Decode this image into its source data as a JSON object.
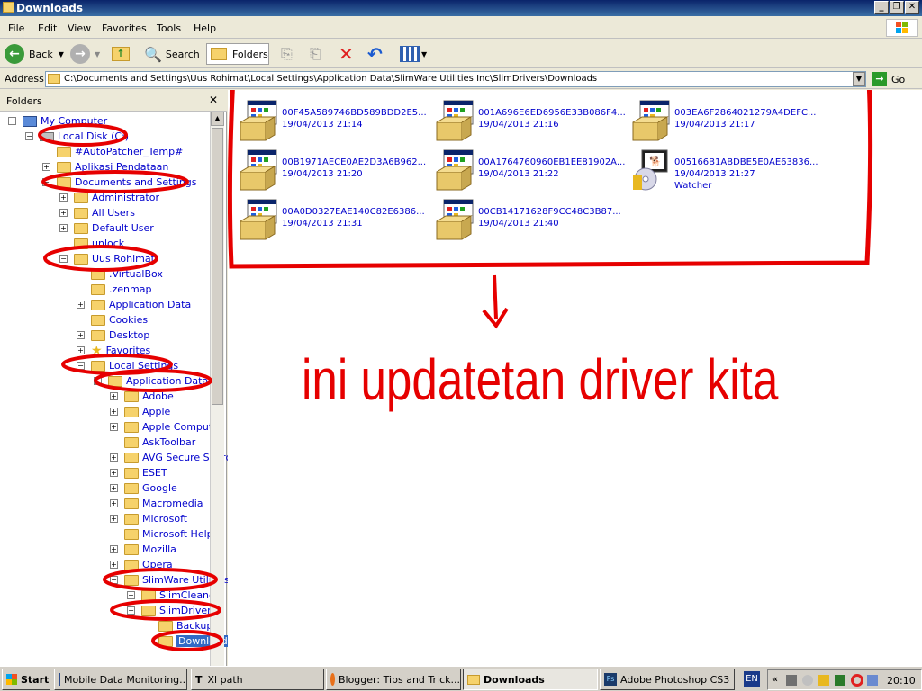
{
  "window": {
    "title": "Downloads"
  },
  "menu": [
    "File",
    "Edit",
    "View",
    "Favorites",
    "Tools",
    "Help"
  ],
  "toolbar": {
    "back": "Back",
    "search": "Search",
    "folders": "Folders"
  },
  "address": {
    "label": "Address",
    "value": "C:\\Documents and Settings\\Uus Rohimat\\Local Settings\\Application Data\\SlimWare Utilities Inc\\SlimDrivers\\Downloads",
    "go": "Go"
  },
  "folders_pane": {
    "title": "Folders"
  },
  "tree": [
    {
      "label": "My Computer"
    },
    {
      "label": "Local Disk (C:)"
    },
    {
      "label": "#AutoPatcher_Temp#"
    },
    {
      "label": "Aplikasi Pendataan"
    },
    {
      "label": "Documents and Settings"
    },
    {
      "label": "Administrator"
    },
    {
      "label": "All Users"
    },
    {
      "label": "Default User"
    },
    {
      "label": "unlock"
    },
    {
      "label": "Uus Rohimat"
    },
    {
      "label": ".VirtualBox"
    },
    {
      "label": ".zenmap"
    },
    {
      "label": "Application Data"
    },
    {
      "label": "Cookies"
    },
    {
      "label": "Desktop"
    },
    {
      "label": "Favorites"
    },
    {
      "label": "Local Settings"
    },
    {
      "label": "Application Data"
    },
    {
      "label": "Adobe"
    },
    {
      "label": "Apple"
    },
    {
      "label": "Apple Computer"
    },
    {
      "label": "AskToolbar"
    },
    {
      "label": "AVG Secure Search"
    },
    {
      "label": "ESET"
    },
    {
      "label": "Google"
    },
    {
      "label": "Macromedia"
    },
    {
      "label": "Microsoft"
    },
    {
      "label": "Microsoft Help"
    },
    {
      "label": "Mozilla"
    },
    {
      "label": "Opera"
    },
    {
      "label": "SlimWare Utilities"
    },
    {
      "label": "SlimCleaner"
    },
    {
      "label": "SlimDrivers"
    },
    {
      "label": "Backup"
    },
    {
      "label": "Downloads"
    }
  ],
  "files": [
    {
      "name": "00F45A589746BD589BDD2E5...",
      "date": "19/04/2013 21:14",
      "extra": ""
    },
    {
      "name": "001A696E6ED6956E33B086F4...",
      "date": "19/04/2013 21:16",
      "extra": ""
    },
    {
      "name": "003EA6F2864021279A4DEFC...",
      "date": "19/04/2013 21:17",
      "extra": ""
    },
    {
      "name": "00B1971AECE0AE2D3A6B962...",
      "date": "19/04/2013 21:20",
      "extra": ""
    },
    {
      "name": "00A1764760960EB1EE81902A...",
      "date": "19/04/2013 21:22",
      "extra": ""
    },
    {
      "name": "005166B1ABDBE5E0AE63836...",
      "date": "19/04/2013 21:27",
      "extra": "Watcher"
    },
    {
      "name": "00A0D0327EAE140C82E6386...",
      "date": "19/04/2013 21:31",
      "extra": ""
    },
    {
      "name": "00CB14171628F9CC48C3B87...",
      "date": "19/04/2013 21:40",
      "extra": ""
    }
  ],
  "annotation": "ini updatetan driver kita",
  "taskbar": {
    "start": "Start",
    "tasks": [
      "Mobile Data Monitoring...",
      "Xl path",
      "Blogger: Tips and Trick...",
      "Downloads",
      "Adobe Photoshop CS3"
    ],
    "lang": "EN",
    "clock": "20:10"
  },
  "colors": {
    "annotation": "#e60000",
    "link": "#0000cc"
  }
}
